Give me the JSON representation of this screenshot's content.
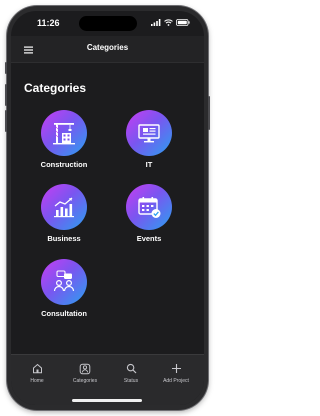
{
  "status_bar": {
    "time": "11:26"
  },
  "app_bar": {
    "title": "Categories",
    "menu_icon": "hamburger-menu-icon"
  },
  "page": {
    "heading": "Categories"
  },
  "categories": [
    {
      "label": "Construction",
      "icon": "construction-crane-icon"
    },
    {
      "label": "IT",
      "icon": "computer-monitor-icon"
    },
    {
      "label": "Business",
      "icon": "growth-chart-icon"
    },
    {
      "label": "Events",
      "icon": "calendar-check-icon"
    },
    {
      "label": "Consultation",
      "icon": "people-chat-icon"
    }
  ],
  "tab_bar": {
    "items": [
      {
        "label": "Home",
        "icon": "home-icon"
      },
      {
        "label": "Categories",
        "icon": "categories-icon"
      },
      {
        "label": "Status",
        "icon": "search-icon"
      },
      {
        "label": "Add Project",
        "icon": "plus-icon"
      }
    ]
  },
  "colors": {
    "background": "#1c1c1e",
    "gradient_start": "#c83df2",
    "gradient_end": "#2aa0f0",
    "text": "#ffffff"
  }
}
